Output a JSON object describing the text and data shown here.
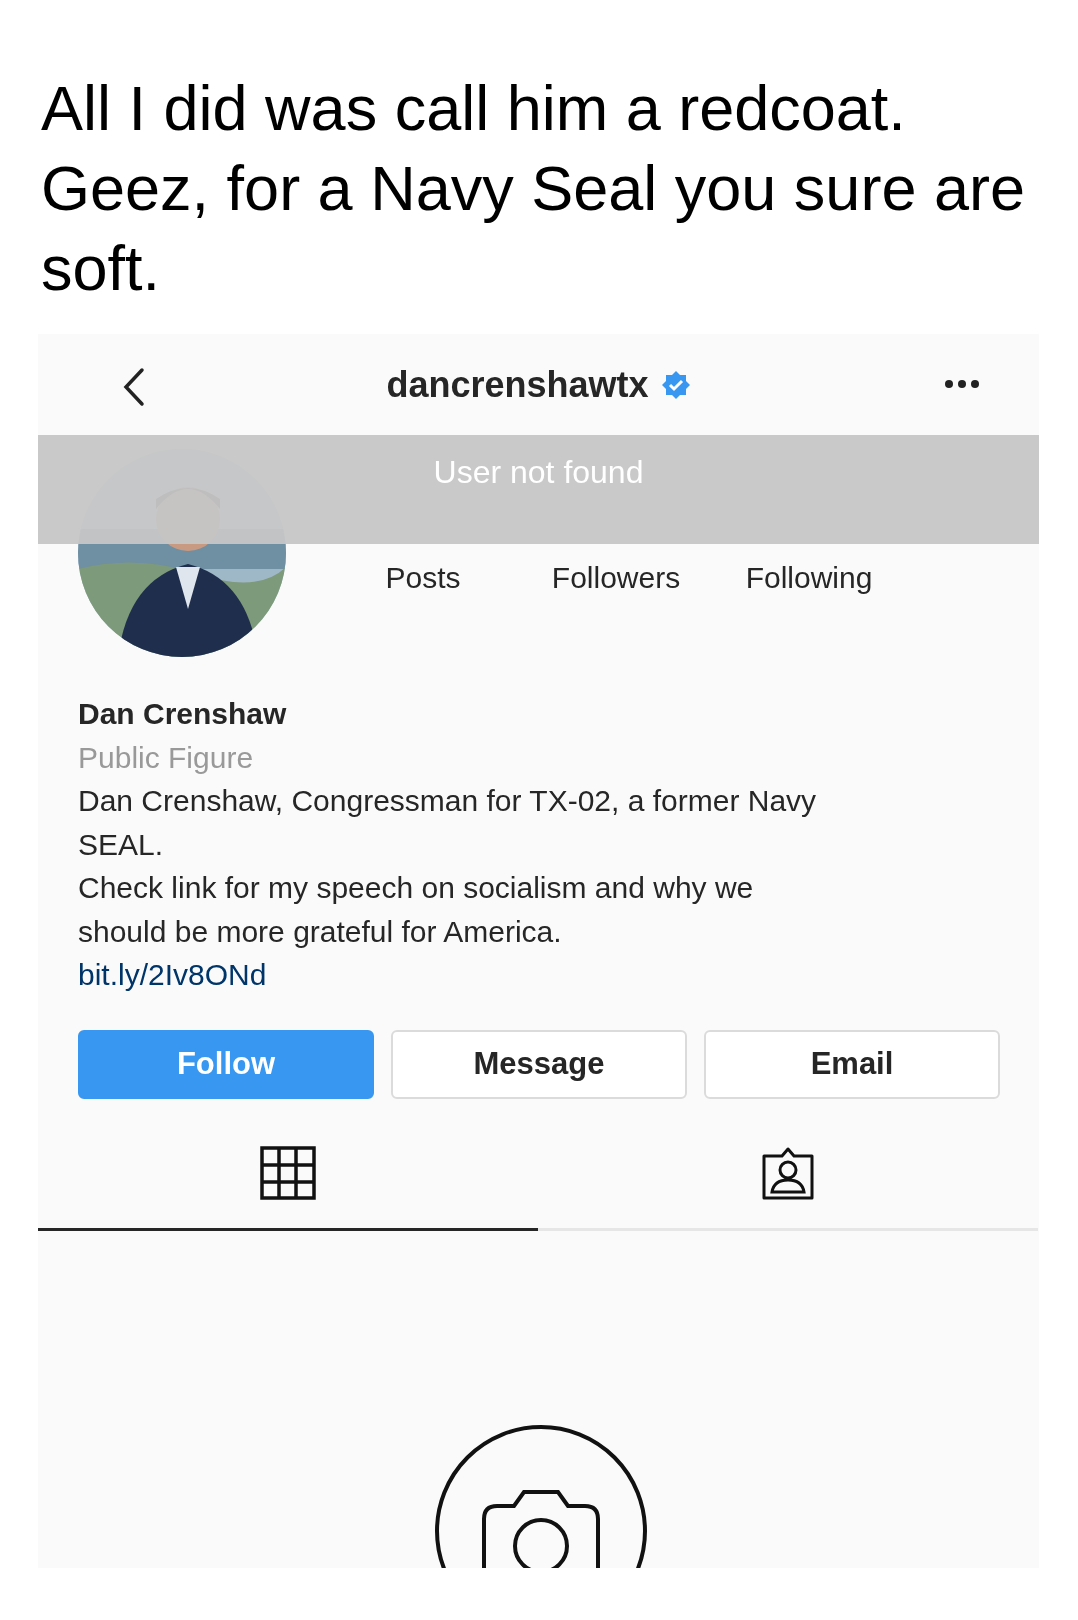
{
  "caption": "All I did was call him a redcoat. Geez, for a Navy Seal you sure are soft.",
  "header": {
    "username": "dancrenshawtx",
    "verified": true
  },
  "banner": "User not found",
  "stats": [
    {
      "label": "Posts"
    },
    {
      "label": "Followers"
    },
    {
      "label": "Following"
    }
  ],
  "name": "Dan Crenshaw",
  "category": "Public Figure",
  "bio": [
    "Dan Crenshaw, Congressman for TX-02, a former Navy SEAL.",
    "Check link for my speech on socialism and why we should be more grateful for America."
  ],
  "link": "bit.ly/2Iv8ONd",
  "buttons": [
    {
      "label": "Follow",
      "kind": "primary"
    },
    {
      "label": "Message",
      "kind": "secondary"
    },
    {
      "label": "Email",
      "kind": "secondary"
    }
  ],
  "tabs": [
    {
      "kind": "grid",
      "selected": true
    },
    {
      "kind": "tagged",
      "selected": false
    }
  ]
}
